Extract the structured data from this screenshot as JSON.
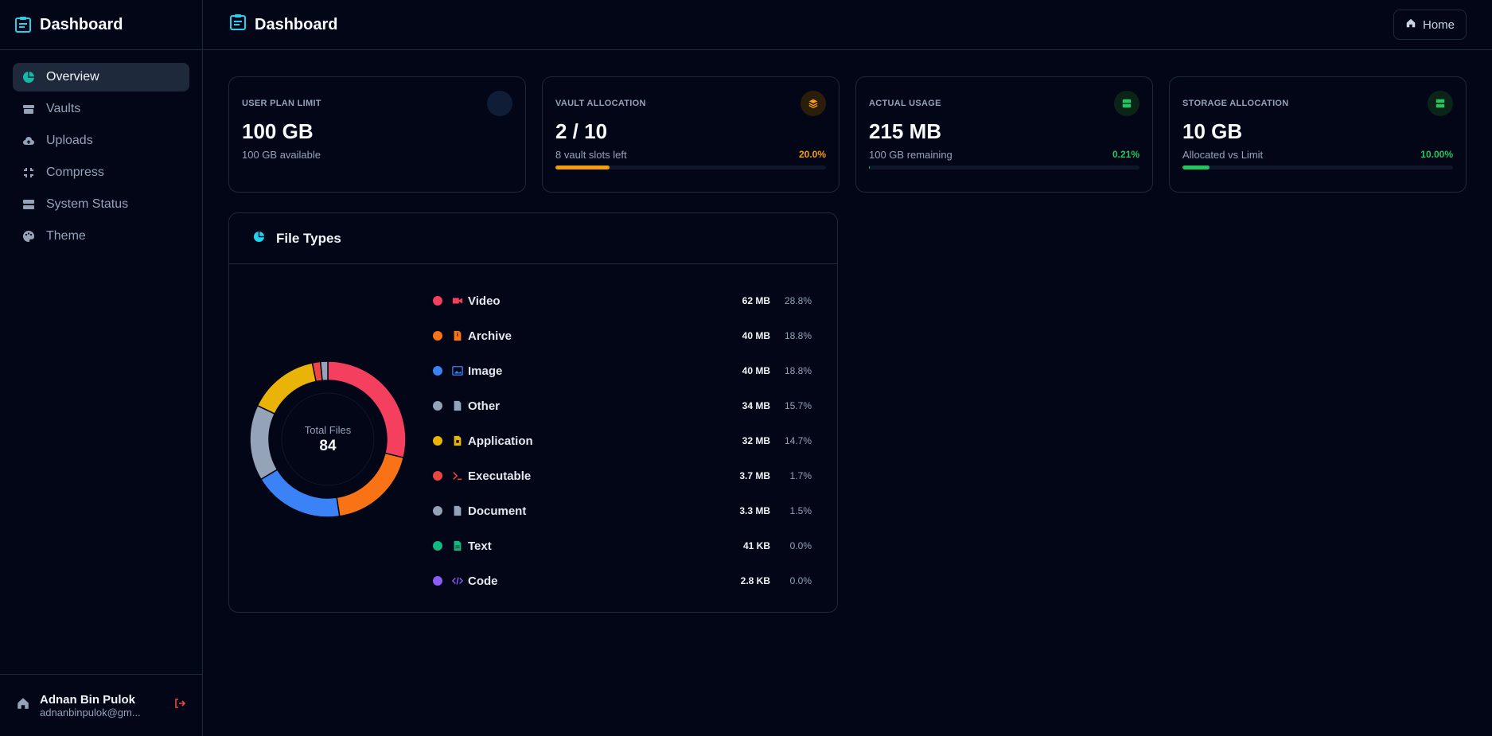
{
  "sidebar": {
    "brand": "Dashboard",
    "items": [
      {
        "label": "Overview",
        "icon": "chart-pie-icon",
        "active": true
      },
      {
        "label": "Vaults",
        "icon": "box-icon"
      },
      {
        "label": "Uploads",
        "icon": "cloud-upload-icon"
      },
      {
        "label": "Compress",
        "icon": "compress-icon"
      },
      {
        "label": "System Status",
        "icon": "server-icon"
      },
      {
        "label": "Theme",
        "icon": "palette-icon"
      }
    ],
    "user": {
      "name": "Adnan Bin Pulok",
      "email": "adnanbinpulok@gm..."
    }
  },
  "header": {
    "title": "Dashboard",
    "home_label": "Home"
  },
  "cards": [
    {
      "label": "USER PLAN LIMIT",
      "value": "100 GB",
      "sub": "100 GB available"
    },
    {
      "label": "VAULT ALLOCATION",
      "value": "2 / 10",
      "sub": "8 vault slots left",
      "pct": "20.0%",
      "fill": 0.2,
      "color": "#f59e0b"
    },
    {
      "label": "ACTUAL USAGE",
      "value": "215 MB",
      "sub": "100 GB remaining",
      "pct": "0.21%",
      "fill": 0.0021,
      "color": "#22c55e"
    },
    {
      "label": "STORAGE ALLOCATION",
      "value": "10 GB",
      "sub": "Allocated vs Limit",
      "pct": "10.00%",
      "fill": 0.1,
      "color": "#22c55e"
    }
  ],
  "file_types": {
    "title": "File Types",
    "total_label": "Total Files",
    "total_value": "84",
    "items": [
      {
        "name": "Video",
        "size": "62 MB",
        "pct": "28.8%",
        "share": 28.8,
        "color": "#f43f5e",
        "icon": "video-icon"
      },
      {
        "name": "Archive",
        "size": "40 MB",
        "pct": "18.8%",
        "share": 18.8,
        "color": "#f97316",
        "icon": "archive-file-icon"
      },
      {
        "name": "Image",
        "size": "40 MB",
        "pct": "18.8%",
        "share": 18.8,
        "color": "#3b82f6",
        "icon": "image-icon"
      },
      {
        "name": "Other",
        "size": "34 MB",
        "pct": "15.7%",
        "share": 15.7,
        "color": "#94a3b8",
        "icon": "file-icon"
      },
      {
        "name": "Application",
        "size": "32 MB",
        "pct": "14.7%",
        "share": 14.7,
        "color": "#eab308",
        "icon": "app-file-icon"
      },
      {
        "name": "Executable",
        "size": "3.7 MB",
        "pct": "1.7%",
        "share": 1.7,
        "color": "#ef4444",
        "icon": "terminal-icon"
      },
      {
        "name": "Document",
        "size": "3.3 MB",
        "pct": "1.5%",
        "share": 1.5,
        "color": "#94a3b8",
        "icon": "document-icon"
      },
      {
        "name": "Text",
        "size": "41 KB",
        "pct": "0.0%",
        "share": 0.0,
        "color": "#10b981",
        "icon": "text-file-icon"
      },
      {
        "name": "Code",
        "size": "2.8 KB",
        "pct": "0.0%",
        "share": 0.0,
        "color": "#8b5cf6",
        "icon": "code-icon"
      }
    ]
  }
}
